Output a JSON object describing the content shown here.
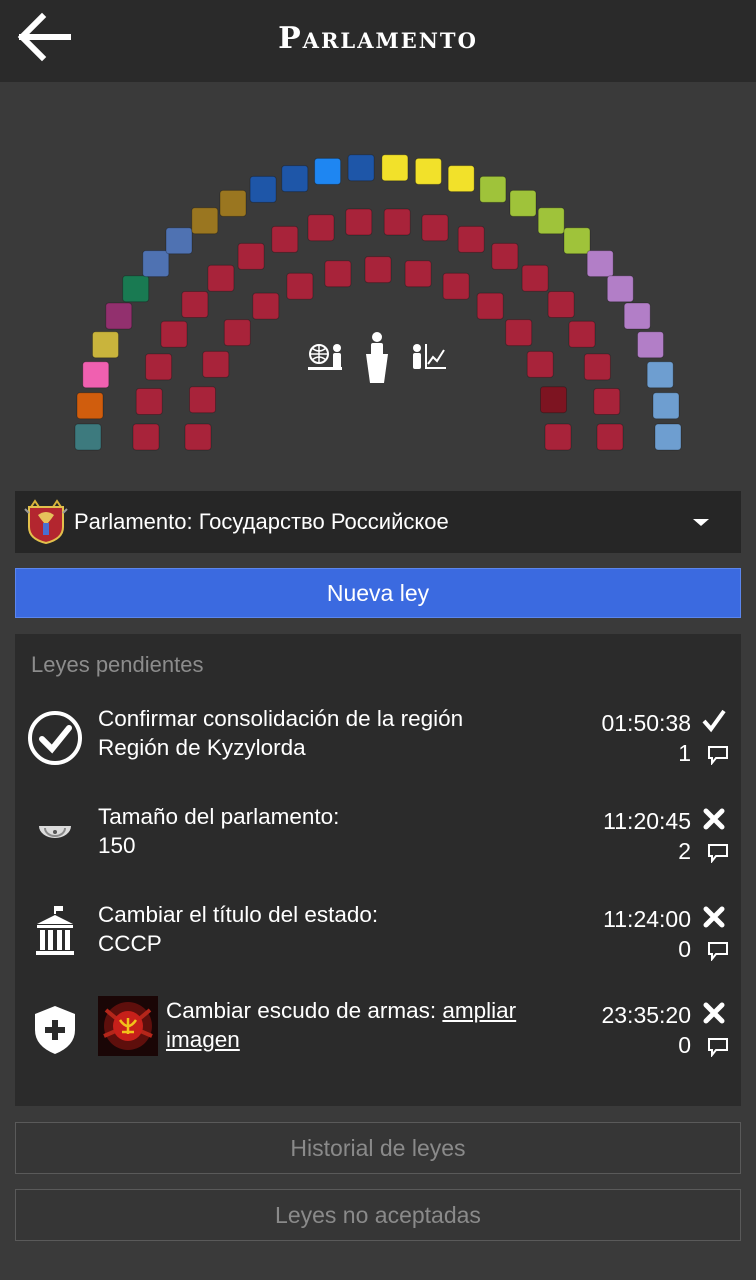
{
  "header": {
    "title": "Parlamento",
    "back_icon": "arrow-left-icon"
  },
  "hemicycle": {
    "center_icons": [
      "globe-advisor-icon",
      "podium-speaker-icon",
      "economy-chart-icon"
    ],
    "colors": {
      "red": "#a8233a",
      "red_highlight": "#7d1421",
      "teal": "#3d7a7e",
      "orange": "#d05d0d",
      "pink": "#f060b0",
      "olive": "#c9b43c",
      "purple": "#92306e",
      "green": "#197a52",
      "slate": "#4f72b2",
      "bronze": "#9a7620",
      "navy": "#1e56a8",
      "blue": "#1e86f2",
      "yellow": "#f2e12a",
      "lime": "#9fc33a",
      "lavender": "#b27ec7",
      "sky": "#6e9ed0"
    }
  },
  "parliament_select": {
    "label": "Parlamento: Государство Российское",
    "emblem_icon": "coat-of-arms-icon"
  },
  "new_law_button": "Nueva ley",
  "pending": {
    "title": "Leyes pendientes",
    "laws": [
      {
        "icon": "check-circle-icon",
        "line1": "Confirmar consolidación de la región",
        "line2": "Región de Kyzylorda",
        "time": "01:50:38",
        "status": "approved",
        "comments": "1"
      },
      {
        "icon": "hemicycle-icon",
        "line1": "Tamaño del parlamento:",
        "line2": "150",
        "time": "11:20:45",
        "status": "rejected",
        "comments": "2"
      },
      {
        "icon": "government-building-icon",
        "line1": "Cambiar el título del estado:",
        "line2": "СССР",
        "time": "11:24:00",
        "status": "rejected",
        "comments": "0"
      },
      {
        "icon": "shield-plus-icon",
        "line1": "Cambiar escudo de armas:",
        "link": "ampliar imagen",
        "time": "23:35:20",
        "status": "rejected",
        "comments": "0"
      }
    ]
  },
  "history_button": "Historial de leyes",
  "rejected_button": "Leyes no aceptadas"
}
